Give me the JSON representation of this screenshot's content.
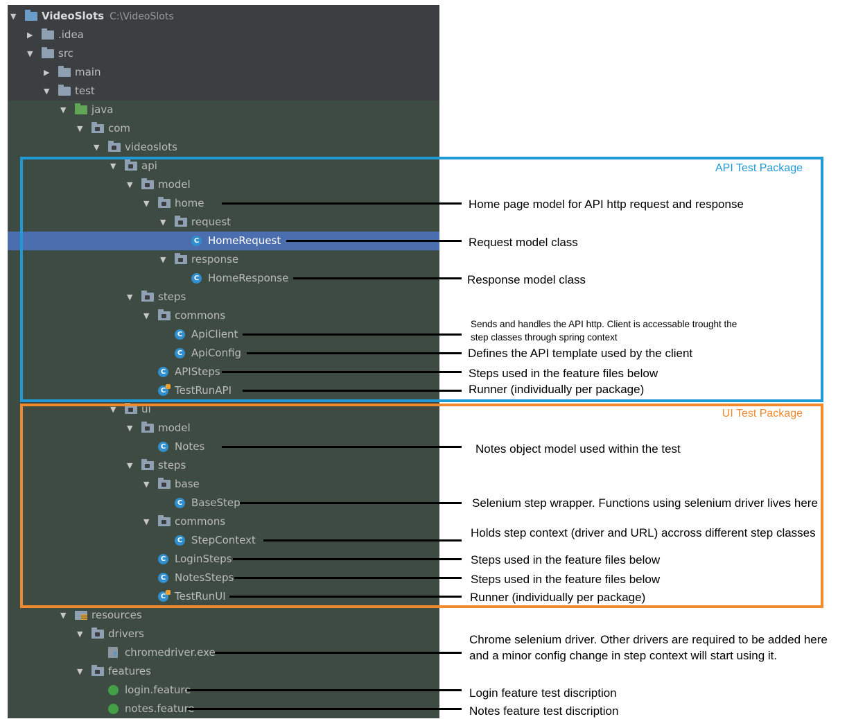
{
  "tree": [
    {
      "label": "VideoSlots",
      "path": "C:\\VideoSlots",
      "icon": "project-folder-icon",
      "arrow": "down",
      "bold": true
    },
    {
      "label": ".idea",
      "icon": "folder-icon",
      "arrow": "right"
    },
    {
      "label": "src",
      "icon": "folder-icon",
      "arrow": "down"
    },
    {
      "label": "main",
      "icon": "folder-icon",
      "arrow": "right"
    },
    {
      "label": "test",
      "icon": "folder-icon",
      "arrow": "down"
    },
    {
      "label": "java",
      "icon": "test-source-folder-icon",
      "arrow": "down"
    },
    {
      "label": "com",
      "icon": "package-icon",
      "arrow": "down"
    },
    {
      "label": "videoslots",
      "icon": "package-icon",
      "arrow": "down"
    },
    {
      "label": "api",
      "icon": "package-icon",
      "arrow": "down"
    },
    {
      "label": "model",
      "icon": "package-icon",
      "arrow": "down"
    },
    {
      "label": "home",
      "icon": "package-icon",
      "arrow": "down"
    },
    {
      "label": "request",
      "icon": "package-icon",
      "arrow": "down"
    },
    {
      "label": "HomeRequest",
      "icon": "class-icon",
      "selected": true
    },
    {
      "label": "response",
      "icon": "package-icon",
      "arrow": "down"
    },
    {
      "label": "HomeResponse",
      "icon": "class-icon"
    },
    {
      "label": "steps",
      "icon": "package-icon",
      "arrow": "down"
    },
    {
      "label": "commons",
      "icon": "package-icon",
      "arrow": "down"
    },
    {
      "label": "ApiClient",
      "icon": "class-icon"
    },
    {
      "label": "ApiConfig",
      "icon": "class-icon"
    },
    {
      "label": "APISteps",
      "icon": "class-icon"
    },
    {
      "label": "TestRunAPI",
      "icon": "runner-class-icon"
    },
    {
      "label": "ui",
      "icon": "package-icon",
      "arrow": "down"
    },
    {
      "label": "model",
      "icon": "package-icon",
      "arrow": "down"
    },
    {
      "label": "Notes",
      "icon": "class-icon"
    },
    {
      "label": "steps",
      "icon": "package-icon",
      "arrow": "down"
    },
    {
      "label": "base",
      "icon": "package-icon",
      "arrow": "down"
    },
    {
      "label": "BaseStep",
      "icon": "class-icon"
    },
    {
      "label": "commons",
      "icon": "package-icon",
      "arrow": "down"
    },
    {
      "label": "StepContext",
      "icon": "class-icon"
    },
    {
      "label": "LoginSteps",
      "icon": "class-icon"
    },
    {
      "label": "NotesSteps",
      "icon": "class-icon"
    },
    {
      "label": "TestRunUI",
      "icon": "runner-class-icon"
    },
    {
      "label": "resources",
      "icon": "resources-folder-icon",
      "arrow": "down"
    },
    {
      "label": "drivers",
      "icon": "package-icon",
      "arrow": "down"
    },
    {
      "label": "chromedriver.exe",
      "icon": "unknown-file-icon"
    },
    {
      "label": "features",
      "icon": "package-icon",
      "arrow": "down"
    },
    {
      "label": "login.feature",
      "icon": "feature-file-icon"
    },
    {
      "label": "notes.feature",
      "icon": "feature-file-icon"
    }
  ],
  "boxes": {
    "api_title": "API Test Package",
    "ui_title": "UI Test Package",
    "api_color": "#1e9bd7",
    "ui_color": "#f08a2d"
  },
  "annotations": [
    {
      "target": "home",
      "text": "Home page model for API http request and response"
    },
    {
      "target": "HomeRequest",
      "text": "Request model class"
    },
    {
      "target": "HomeResponse",
      "text": "Response model class"
    },
    {
      "target": "ApiClient",
      "text": "Sends and handles the API http. Client is accessable trought the step classes through spring context"
    },
    {
      "target": "ApiConfig",
      "text": "Defines the API template used by the client"
    },
    {
      "target": "APISteps",
      "text": "Steps used in the feature files below"
    },
    {
      "target": "TestRunAPI",
      "text": "Runner (individually per package)"
    },
    {
      "target": "Notes",
      "text": "Notes object model used within the test"
    },
    {
      "target": "BaseStep",
      "text": "Selenium step wrapper. Functions using selenium driver lives here"
    },
    {
      "target": "StepContext",
      "text": "Holds step context (driver and URL) accross different step classes"
    },
    {
      "target": "LoginSteps",
      "text": "Steps used in the feature files below"
    },
    {
      "target": "NotesSteps",
      "text": "Steps used in the feature files below"
    },
    {
      "target": "TestRunUI",
      "text": "Runner (individually per package)"
    },
    {
      "target": "chromedriver.exe",
      "text": "Chrome selenium driver. Other drivers are required to be added here and a minor config change in step context will start using it."
    },
    {
      "target": "login.feature",
      "text": "Login feature test discription"
    },
    {
      "target": "notes.feature",
      "text": "Notes feature test discription"
    }
  ]
}
